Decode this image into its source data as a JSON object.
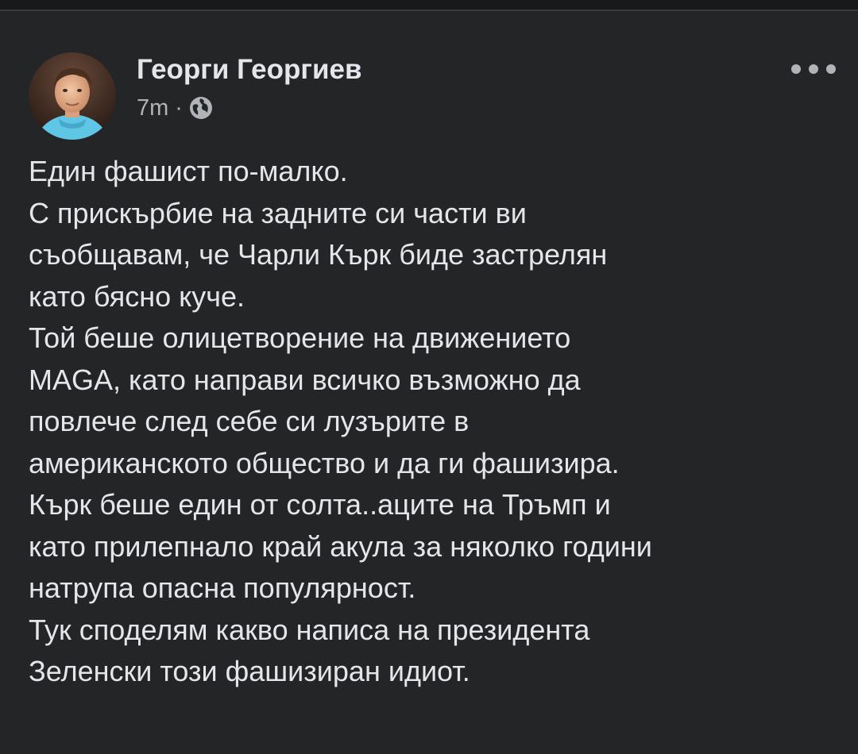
{
  "post": {
    "author": "Георги Георгиев",
    "time": "7m",
    "separator": "·",
    "privacy_icon": "globe-icon",
    "more_icon": "more-options-icon",
    "body_lines": [
      "Един фашист по-малко.",
      "С прискърбие на задните си части ви",
      "съобщавам, че Чарли Кърк биде застрелян",
      "като бясно куче.",
      "Той беше олицетворение на движението",
      "MAGA, като направи всичко възможно да",
      "повлече след себе си лузърите в",
      "американското общество и да ги фашизира.",
      "Кърк беше един от солта..аците на Тръмп и",
      "като прилепнало край акула за няколко години",
      "натрупа опасна популярност.",
      "Тук споделям какво написа на президента",
      "Зеленски този фашизиран идиот."
    ]
  },
  "colors": {
    "background": "#242526",
    "text_primary": "#e4e6eb",
    "text_secondary": "#b0b3b8"
  }
}
